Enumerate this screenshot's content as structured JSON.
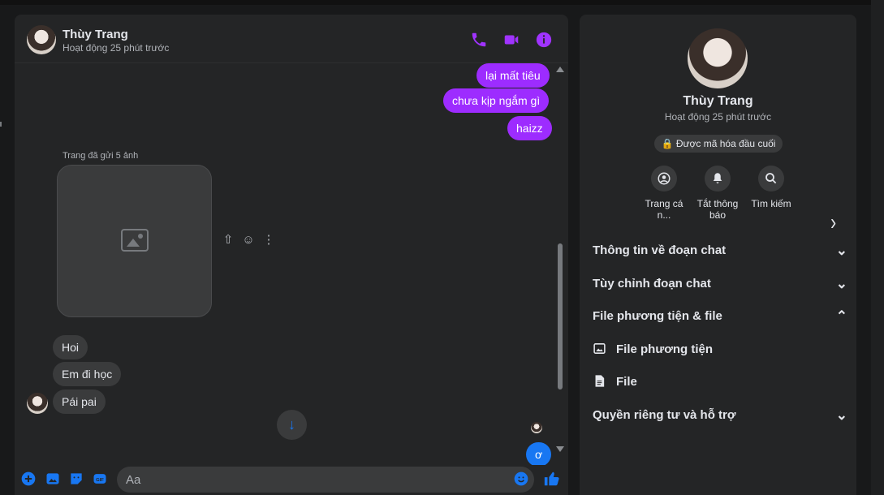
{
  "colors": {
    "background": "#18191a",
    "panel": "#242526",
    "accent_purple": "#9d2cff",
    "accent_blue": "#1877f2",
    "incoming_bubble": "#3a3b3c",
    "text_primary": "#e4e6eb",
    "text_secondary": "#b0b3b8"
  },
  "chat": {
    "header": {
      "name": "Thùy Trang",
      "status": "Hoạt động 25 phút trước",
      "icons": [
        "phone-icon",
        "video-call-icon",
        "info-icon"
      ]
    },
    "messages": {
      "outgoing": [
        {
          "text": "lại mất tiêu"
        },
        {
          "text": "chưa kịp ngắm gì"
        },
        {
          "text": "haizz"
        },
        {
          "text": "ơ"
        }
      ],
      "photo_note": "Trang đã gửi 5 ảnh",
      "incoming": [
        {
          "text": "Hoi"
        },
        {
          "text": "Em đi học"
        },
        {
          "text": "Pái pai"
        }
      ],
      "actions": [
        "share-icon",
        "react-icon",
        "more-icon"
      ]
    },
    "composer": {
      "placeholder": "Aa",
      "icons": [
        "plus-icon",
        "photo-icon",
        "sticker-icon",
        "gif-icon",
        "emoji-icon",
        "like-icon"
      ]
    }
  },
  "info_panel": {
    "name": "Thùy Trang",
    "status": "Hoạt động 25 phút trước",
    "encryption_label": "🔒 Được mã hóa đầu cuối",
    "actions": [
      {
        "label": "Trang cá n...",
        "icon": "profile-icon"
      },
      {
        "label": "Tắt thông báo",
        "icon": "bell-icon"
      },
      {
        "label": "Tìm kiếm",
        "icon": "search-icon"
      }
    ],
    "sections": [
      {
        "label": "Thông tin về đoạn chat",
        "expanded": false
      },
      {
        "label": "Tùy chỉnh đoạn chat",
        "expanded": false
      },
      {
        "label": "File phương tiện & file",
        "expanded": true
      },
      {
        "label": "Quyền riêng tư và hỗ trợ",
        "expanded": false
      }
    ],
    "media_items": [
      {
        "label": "File phương tiện",
        "icon": "media-icon"
      },
      {
        "label": "File",
        "icon": "file-icon"
      }
    ]
  }
}
